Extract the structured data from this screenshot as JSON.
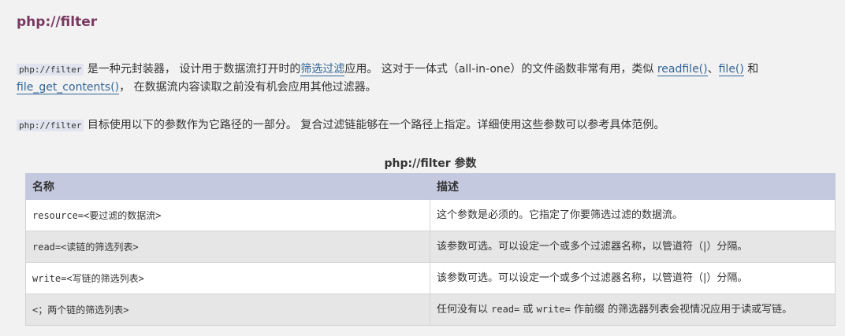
{
  "title": "php://filter",
  "p1": {
    "code": "php://filter",
    "t1": " 是一种元封装器， 设计用于数据流打开时的",
    "link1": "筛选过滤",
    "t2": "应用。 这对于一体式（all-in-one）的文件函数非常有用，类似 ",
    "link2": "readfile()",
    "t3": "、",
    "link3": "file()",
    "t4": " 和 ",
    "link4": "file_get_contents()",
    "t5": "， 在数据流内容读取之前没有机会应用其他过滤器。"
  },
  "p2": {
    "code": "php://filter",
    "t1": " 目标使用以下的参数作为它路径的一部分。 复合过滤链能够在一个路径上指定。详细使用这些参数可以参考具体范例。"
  },
  "table": {
    "caption": "php://filter 参数",
    "headers": [
      "名称",
      "描述"
    ],
    "rows": [
      {
        "name": "resource=<要过滤的数据流>",
        "desc": "这个参数是必须的。它指定了你要筛选过滤的数据流。"
      },
      {
        "name": "read=<读链的筛选列表>",
        "desc": "该参数可选。可以设定一个或多个过滤器名称，以管道符（|）分隔。"
      },
      {
        "name": "write=<写链的筛选列表>",
        "desc": "该参数可选。可以设定一个或多个过滤器名称，以管道符（|）分隔。"
      },
      {
        "name": "<；两个链的筛选列表>",
        "desc_a": "任何没有以 ",
        "desc_code1": "read=",
        "desc_b": " 或 ",
        "desc_code2": "write=",
        "desc_c": " 作前缀 的筛选器列表会视情况应用于读或写链。"
      }
    ]
  }
}
